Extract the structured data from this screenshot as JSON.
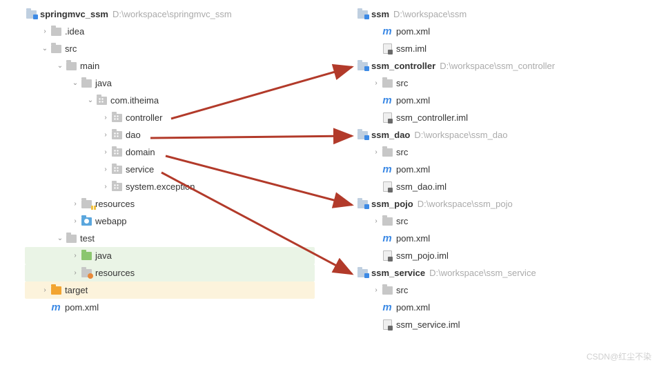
{
  "left": {
    "root": {
      "name": "springmvc_ssm",
      "path": "D:\\workspace\\springmvc_ssm"
    },
    "idea": ".idea",
    "src": "src",
    "main": "main",
    "java": "java",
    "pkg": "com.itheima",
    "controller": "controller",
    "dao": "dao",
    "domain": "domain",
    "service": "service",
    "sysex": "system.exception",
    "resources": "resources",
    "webapp": "webapp",
    "test": "test",
    "test_java": "java",
    "test_resources": "resources",
    "target": "target",
    "pom": "pom.xml"
  },
  "right": {
    "m0": {
      "name": "ssm",
      "path": "D:\\workspace\\ssm",
      "pom": "pom.xml",
      "iml": "ssm.iml"
    },
    "m1": {
      "name": "ssm_controller",
      "path": "D:\\workspace\\ssm_controller",
      "src": "src",
      "pom": "pom.xml",
      "iml": "ssm_controller.iml"
    },
    "m2": {
      "name": "ssm_dao",
      "path": "D:\\workspace\\ssm_dao",
      "src": "src",
      "pom": "pom.xml",
      "iml": "ssm_dao.iml"
    },
    "m3": {
      "name": "ssm_pojo",
      "path": "D:\\workspace\\ssm_pojo",
      "src": "src",
      "pom": "pom.xml",
      "iml": "ssm_pojo.iml"
    },
    "m4": {
      "name": "ssm_service",
      "path": "D:\\workspace\\ssm_service",
      "src": "src",
      "pom": "pom.xml",
      "iml": "ssm_service.iml"
    }
  },
  "watermark": "CSDN@红尘不染",
  "diagram": {
    "arrows": [
      {
        "from": "controller",
        "to": "ssm_controller"
      },
      {
        "from": "dao",
        "to": "ssm_dao"
      },
      {
        "from": "domain",
        "to": "ssm_pojo"
      },
      {
        "from": "service",
        "to": "ssm_service"
      }
    ]
  }
}
